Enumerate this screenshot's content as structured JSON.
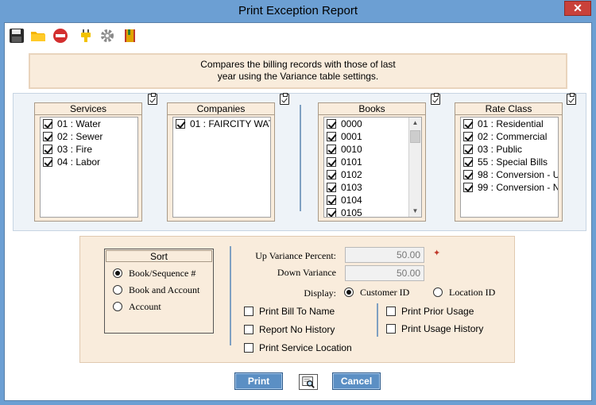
{
  "window": {
    "title": "Print Exception Report",
    "close_label": "✕"
  },
  "toolbar": {
    "icons": [
      "save-icon",
      "open-folder-icon",
      "stop-icon",
      "plug-icon",
      "gear-icon",
      "book-icon"
    ]
  },
  "description": {
    "line1": "Compares the billing records with those of last",
    "line2": "year using the Variance table settings."
  },
  "services": {
    "header": "Services",
    "items": [
      {
        "label": "01 : Water",
        "checked": true
      },
      {
        "label": "02 : Sewer",
        "checked": true
      },
      {
        "label": "03 : Fire",
        "checked": true
      },
      {
        "label": "04 : Labor",
        "checked": true
      }
    ]
  },
  "companies": {
    "header": "Companies",
    "items": [
      {
        "label": "01 : FAIRCITY WAT",
        "checked": true
      }
    ]
  },
  "books": {
    "header": "Books",
    "items": [
      {
        "label": "0000",
        "checked": true
      },
      {
        "label": "0001",
        "checked": true
      },
      {
        "label": "0010",
        "checked": true
      },
      {
        "label": "0101",
        "checked": true
      },
      {
        "label": "0102",
        "checked": true
      },
      {
        "label": "0103",
        "checked": true
      },
      {
        "label": "0104",
        "checked": true
      },
      {
        "label": "0105",
        "checked": true
      }
    ]
  },
  "rate_class": {
    "header": "Rate Class",
    "items": [
      {
        "label": "01 : Residential",
        "checked": true
      },
      {
        "label": "02 : Commercial",
        "checked": true
      },
      {
        "label": "03 : Public",
        "checked": true
      },
      {
        "label": "55 : Special Bills",
        "checked": true
      },
      {
        "label": "98 : Conversion - U",
        "checked": true
      },
      {
        "label": "99 : Conversion - N",
        "checked": true
      }
    ]
  },
  "sort": {
    "header": "Sort",
    "options": [
      {
        "label": "Book/Sequence #",
        "selected": true
      },
      {
        "label": "Book and Account",
        "selected": false
      },
      {
        "label": "Account",
        "selected": false
      }
    ]
  },
  "variance": {
    "up_label": "Up Variance Percent:",
    "up_value": "50.00",
    "down_label": "Down Variance",
    "down_value": "50.00",
    "required_mark": "✦"
  },
  "display": {
    "label": "Display:",
    "customer_label": "Customer ID",
    "location_label": "Location ID",
    "selected": "customer"
  },
  "checkboxes": {
    "print_bill_to_name": "Print Bill To Name",
    "report_no_history": "Report No History",
    "print_service_location": "Print Service Location",
    "print_prior_usage": "Print Prior Usage",
    "print_usage_history": "Print Usage History"
  },
  "buttons": {
    "print": "Print",
    "cancel": "Cancel"
  }
}
